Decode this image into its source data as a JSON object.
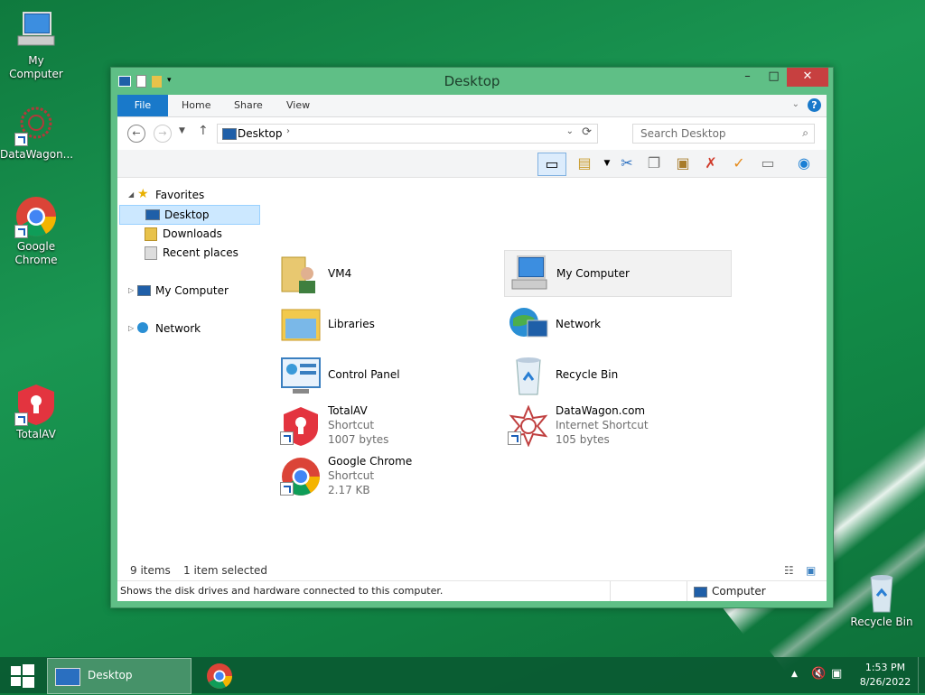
{
  "desktop": {
    "icons": [
      {
        "label": "My Computer"
      },
      {
        "label": "DataWagon..."
      },
      {
        "label": "Google Chrome"
      },
      {
        "label": "TotalAV"
      },
      {
        "label": "Recycle Bin"
      }
    ]
  },
  "window": {
    "title": "Desktop",
    "buttons": {
      "minimize": "–",
      "maximize": "□",
      "close": "✕"
    },
    "ribbon_tabs": [
      "File",
      "Home",
      "Share",
      "View"
    ],
    "help": "?",
    "address": {
      "path": "Desktop"
    },
    "search": {
      "placeholder": "Search Desktop"
    },
    "nav_pane": {
      "favorites": "Favorites",
      "items": [
        "Desktop",
        "Downloads",
        "Recent places"
      ],
      "my_computer": "My Computer",
      "network": "Network"
    },
    "files": [
      {
        "name": "VM4",
        "lines": []
      },
      {
        "name": "My Computer",
        "lines": []
      },
      {
        "name": "Libraries",
        "lines": []
      },
      {
        "name": "Network",
        "lines": []
      },
      {
        "name": "Control Panel",
        "lines": []
      },
      {
        "name": "Recycle Bin",
        "lines": []
      },
      {
        "name": "TotalAV",
        "lines": [
          "Shortcut",
          "1007 bytes"
        ]
      },
      {
        "name": "DataWagon.com",
        "lines": [
          "Internet Shortcut",
          "105 bytes"
        ]
      },
      {
        "name": "Google Chrome",
        "lines": [
          "Shortcut",
          "2.17 KB"
        ]
      }
    ],
    "status": {
      "count": "9 items",
      "selected": "1 item selected"
    },
    "details": {
      "description": "Shows the disk drives and hardware connected to this computer.",
      "location": "Computer"
    }
  },
  "taskbar": {
    "active_app": "Desktop",
    "time": "1:53 PM",
    "date": "8/26/2022"
  },
  "colors": {
    "accent": "#1979ca",
    "selection": "#cce8ff",
    "taskbar": "#0a5a32"
  }
}
